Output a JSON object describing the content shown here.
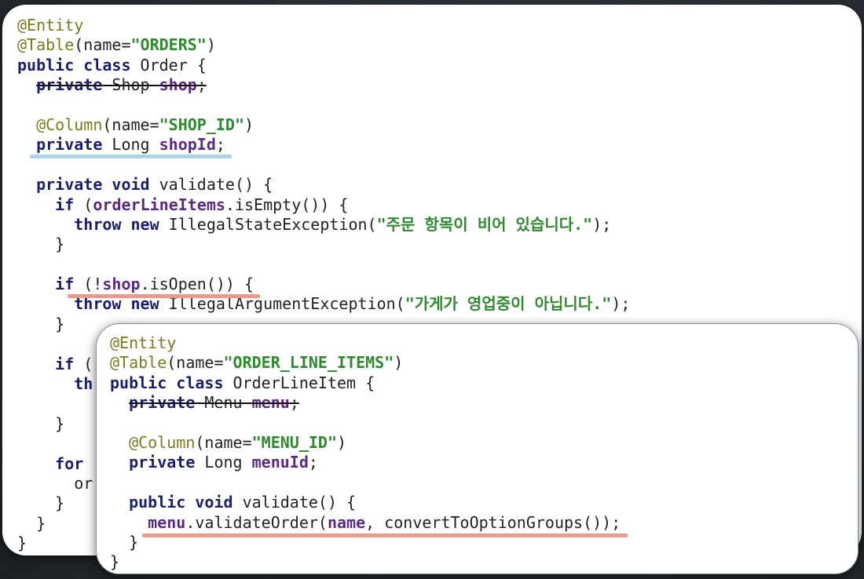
{
  "order_class": {
    "lines": [
      [
        {
          "t": "@Entity",
          "c": "ann"
        }
      ],
      [
        {
          "t": "@Table",
          "c": "ann"
        },
        {
          "t": "(name=",
          "c": "plain"
        },
        {
          "t": "\"ORDERS\"",
          "c": "str"
        },
        {
          "t": ")",
          "c": "plain"
        }
      ],
      [
        {
          "t": "public class",
          "c": "kw"
        },
        {
          "t": " Order {",
          "c": "plain"
        }
      ],
      [
        {
          "t": "  "
        },
        {
          "t": "private",
          "c": "kw strike"
        },
        {
          "t": " Shop ",
          "c": "plain strike"
        },
        {
          "t": "shop",
          "c": "fld strike"
        },
        {
          "t": ";",
          "c": "plain strike"
        }
      ],
      [
        {
          "t": ""
        }
      ],
      [
        {
          "t": "  "
        },
        {
          "t": "@Column",
          "c": "ann"
        },
        {
          "t": "(name=",
          "c": "plain"
        },
        {
          "t": "\"SHOP_ID\"",
          "c": "str"
        },
        {
          "t": ")",
          "c": "plain"
        }
      ],
      [
        {
          "t": "  "
        },
        {
          "t": "private",
          "c": "kw"
        },
        {
          "t": " Long ",
          "c": "plain"
        },
        {
          "t": "shopId",
          "c": "fld"
        },
        {
          "t": ";",
          "c": "plain"
        }
      ],
      [
        {
          "t": ""
        }
      ],
      [
        {
          "t": "  "
        },
        {
          "t": "private void",
          "c": "kw"
        },
        {
          "t": " validate() {",
          "c": "plain"
        }
      ],
      [
        {
          "t": "    "
        },
        {
          "t": "if",
          "c": "kw"
        },
        {
          "t": " (",
          "c": "plain"
        },
        {
          "t": "orderLineItems",
          "c": "fld"
        },
        {
          "t": ".isEmpty()) {",
          "c": "plain"
        }
      ],
      [
        {
          "t": "      "
        },
        {
          "t": "throw new",
          "c": "kw"
        },
        {
          "t": " IllegalStateException(",
          "c": "plain"
        },
        {
          "t": "\"주문 항목이 비어 있습니다.\"",
          "c": "str"
        },
        {
          "t": ");",
          "c": "plain"
        }
      ],
      [
        {
          "t": "    }",
          "c": "plain"
        }
      ],
      [
        {
          "t": ""
        }
      ],
      [
        {
          "t": "    "
        },
        {
          "t": "if",
          "c": "kw"
        },
        {
          "t": " (!",
          "c": "plain"
        },
        {
          "t": "shop",
          "c": "fld"
        },
        {
          "t": ".isOpen()) {",
          "c": "plain"
        }
      ],
      [
        {
          "t": "      "
        },
        {
          "t": "throw new",
          "c": "kw"
        },
        {
          "t": " IllegalArgumentException(",
          "c": "plain"
        },
        {
          "t": "\"가게가 영업중이 아닙니다.\"",
          "c": "str"
        },
        {
          "t": ");",
          "c": "plain"
        }
      ],
      [
        {
          "t": "    }",
          "c": "plain"
        }
      ],
      [
        {
          "t": ""
        }
      ],
      [
        {
          "t": "    "
        },
        {
          "t": "if",
          "c": "kw"
        },
        {
          "t": " (",
          "c": "plain"
        }
      ],
      [
        {
          "t": "      "
        },
        {
          "t": "th",
          "c": "kw"
        }
      ],
      [
        {
          "t": ""
        }
      ],
      [
        {
          "t": "    }",
          "c": "plain"
        }
      ],
      [
        {
          "t": ""
        }
      ],
      [
        {
          "t": "    "
        },
        {
          "t": "for",
          "c": "kw"
        }
      ],
      [
        {
          "t": "      or",
          "c": "plain"
        }
      ],
      [
        {
          "t": "    }",
          "c": "plain"
        }
      ],
      [
        {
          "t": "  }",
          "c": "plain"
        }
      ],
      [
        {
          "t": "}",
          "c": "plain"
        }
      ]
    ]
  },
  "order_line_item_class": {
    "lines": [
      [
        {
          "t": "@Entity",
          "c": "ann"
        }
      ],
      [
        {
          "t": "@Table",
          "c": "ann"
        },
        {
          "t": "(name=",
          "c": "plain"
        },
        {
          "t": "\"ORDER_LINE_ITEMS\"",
          "c": "str"
        },
        {
          "t": ")",
          "c": "plain"
        }
      ],
      [
        {
          "t": "public class",
          "c": "kw"
        },
        {
          "t": " OrderLineItem {",
          "c": "plain"
        }
      ],
      [
        {
          "t": "  "
        },
        {
          "t": "private",
          "c": "kw strike"
        },
        {
          "t": " Menu ",
          "c": "plain strike"
        },
        {
          "t": "menu",
          "c": "fld strike"
        },
        {
          "t": ";",
          "c": "plain strike"
        }
      ],
      [
        {
          "t": ""
        }
      ],
      [
        {
          "t": "  "
        },
        {
          "t": "@Column",
          "c": "ann"
        },
        {
          "t": "(name=",
          "c": "plain"
        },
        {
          "t": "\"MENU_ID\"",
          "c": "str"
        },
        {
          "t": ")",
          "c": "plain"
        }
      ],
      [
        {
          "t": "  "
        },
        {
          "t": "private",
          "c": "kw"
        },
        {
          "t": " Long ",
          "c": "plain"
        },
        {
          "t": "menuId",
          "c": "fld"
        },
        {
          "t": ";",
          "c": "plain"
        }
      ],
      [
        {
          "t": ""
        }
      ],
      [
        {
          "t": "  "
        },
        {
          "t": "public void",
          "c": "kw"
        },
        {
          "t": " validate() {",
          "c": "plain"
        }
      ],
      [
        {
          "t": "    "
        },
        {
          "t": "menu",
          "c": "fld"
        },
        {
          "t": ".validateOrder(",
          "c": "plain"
        },
        {
          "t": "name",
          "c": "fld"
        },
        {
          "t": ", convertToOptionGroups());",
          "c": "plain"
        }
      ],
      [
        {
          "t": "  }",
          "c": "plain"
        }
      ],
      [
        {
          "t": "}",
          "c": "plain"
        }
      ]
    ]
  },
  "highlight_colors": {
    "blue": "#a9d3ea",
    "red": "#ea9a8a"
  }
}
